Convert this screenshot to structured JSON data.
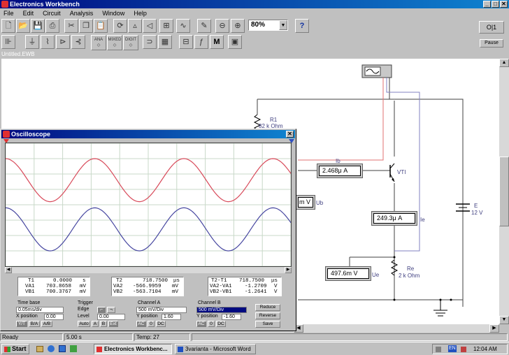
{
  "window": {
    "title": "Electronics Workbench",
    "controls": [
      "_",
      "□",
      "✕"
    ]
  },
  "menu": [
    "File",
    "Edit",
    "Circuit",
    "Analysis",
    "Window",
    "Help"
  ],
  "toolbar": {
    "zoom": "80%",
    "help": "?",
    "power_label": "O|1",
    "pause": "Pause",
    "parts_labels": [
      "ANA",
      "MIXED",
      "DIGIT"
    ],
    "m_label": "M"
  },
  "document": {
    "tab": "Untitled.EWB"
  },
  "circuit": {
    "r1_name": "R1",
    "r1_value": "82 k Ohm",
    "vt_name": "VTI",
    "re_name": "Re",
    "re_value": "2 k Ohm",
    "e_name": "E",
    "e_value": "12 V",
    "ib_label": "Ib",
    "ie_label": "Ie",
    "ub_label": "Ub",
    "ue_label": "Ue",
    "meter_ib": "2.468μ A",
    "meter_ie": "249.3μ A",
    "meter_ue": "497.6m V",
    "meter_ub": "m V"
  },
  "oscilloscope": {
    "title": "Oscilloscope",
    "close": "✕",
    "readout": {
      "t1": {
        "t": "T1",
        "t_val": "0.0000",
        "t_unit": "s",
        "va": "VA1",
        "va_val": "703.8658",
        "va_unit": "mV",
        "vb": "VB1",
        "vb_val": "700.3767",
        "vb_unit": "mV"
      },
      "t2": {
        "t": "T2",
        "t_val": "718.7500",
        "t_unit": "μs",
        "va": "VA2",
        "va_val": "-566.9959",
        "va_unit": "mV",
        "vb": "VB2",
        "vb_val": "-563.7104",
        "vb_unit": "mV"
      },
      "dt": {
        "t": "T2-T1",
        "t_val": "718.7500",
        "t_unit": "μs",
        "va": "VA2-VA1",
        "va_val": "-1.2709",
        "va_unit": "V",
        "vb": "VB2-VB1",
        "vb_val": "-1.2641",
        "vb_unit": "V"
      }
    },
    "timebase": {
      "title": "Time base",
      "value": "0.05ms/div",
      "xpos_label": "X position",
      "xpos": "0.00",
      "modes": [
        "Y/T",
        "B/A",
        "A/B"
      ]
    },
    "trigger": {
      "title": "Trigger",
      "edge_label": "Edge",
      "level_label": "Level",
      "level": "0.00",
      "modes": [
        "Auto",
        "A",
        "B",
        "Ext"
      ]
    },
    "channel_a": {
      "title": "Channel A",
      "value": "500 mV/Div",
      "ypos_label": "Y position",
      "ypos": "1.60",
      "modes": [
        "AC",
        "0",
        "DC"
      ]
    },
    "channel_b": {
      "title": "Channel B",
      "value": "500 mV/Div",
      "ypos_label": "Y position",
      "ypos": "-1.60",
      "modes": [
        "AC",
        "0",
        "DC"
      ]
    },
    "buttons": {
      "reduce": "Reduce",
      "reverse": "Reverse",
      "save": "Save"
    },
    "colors": {
      "channel_a": "#d84a5a",
      "channel_b": "#4646a0"
    }
  },
  "status": {
    "state": "Ready",
    "time": "5.00 s",
    "temp": "Temp: 27"
  },
  "taskbar": {
    "start": "Start",
    "tasks": [
      "Electronics Workbenc...",
      "3varianta - Microsoft Word"
    ],
    "lang": "EN",
    "clock": "12:04 AM"
  }
}
